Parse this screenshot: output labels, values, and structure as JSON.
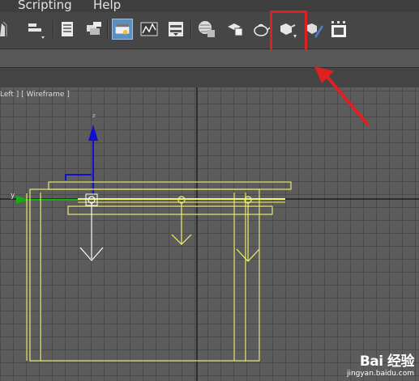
{
  "menu": {
    "scripting": "Scripting",
    "help": "Help"
  },
  "toolbar": {
    "icons": [
      "select-filter-icon",
      "align-icon",
      "layer-manager-icon",
      "scene-explorer-icon",
      "material-editor-icon",
      "curve-editor-icon",
      "schematic-view-icon",
      "render-setup-icon",
      "render-frame-icon",
      "rendered-frame-window-icon",
      "teapot-render-icon",
      "quick-render-icon",
      "active-shade-icon",
      "render-window-icon"
    ],
    "highlight_color": "#e02020"
  },
  "viewport": {
    "label": "Left ] [ Wireframe ]",
    "axis_y_label": "y",
    "axis_z_label": "z"
  },
  "watermark": {
    "brand": "Bai 经验",
    "url": "jingyan.baidu.com"
  }
}
